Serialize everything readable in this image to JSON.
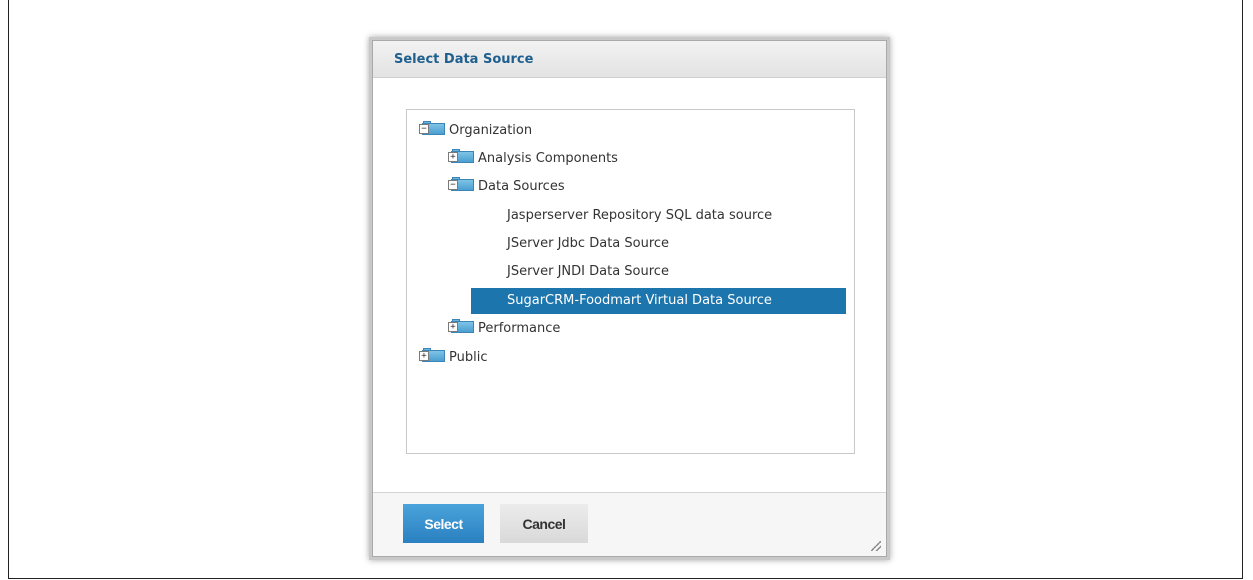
{
  "dialog": {
    "title": "Select Data Source"
  },
  "tree": {
    "organization": {
      "label": "Organization",
      "expanded": true,
      "toggle": "−"
    },
    "analysis_components": {
      "label": "Analysis Components",
      "expanded": false,
      "toggle": "+"
    },
    "data_sources": {
      "label": "Data Sources",
      "expanded": true,
      "toggle": "−"
    },
    "items": [
      {
        "label": "Jasperserver Repository SQL data source"
      },
      {
        "label": "JServer Jdbc Data Source"
      },
      {
        "label": "JServer JNDI Data Source"
      },
      {
        "label": "SugarCRM-Foodmart Virtual Data Source",
        "selected": true
      }
    ],
    "performance": {
      "label": "Performance",
      "expanded": false,
      "toggle": "+"
    },
    "public": {
      "label": "Public",
      "expanded": false,
      "toggle": "+"
    }
  },
  "buttons": {
    "select_label": "Select",
    "cancel_label": "Cancel"
  },
  "colors": {
    "title_text": "#1e5f8e",
    "selection": "#1d75ad",
    "select_button": "#2a80c0"
  },
  "icons": {
    "folder": "folder-icon",
    "collapse": "collapse-icon",
    "expand": "expand-icon",
    "resize": "resize-grip-icon"
  }
}
